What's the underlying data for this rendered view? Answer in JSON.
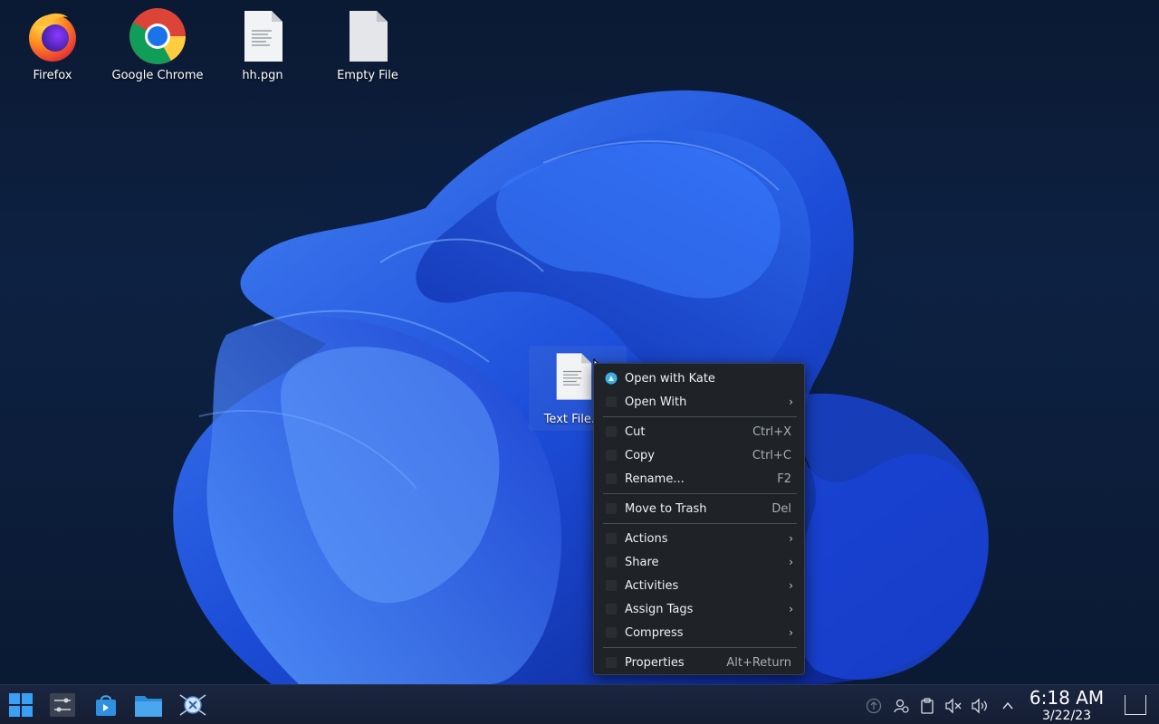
{
  "desktop": {
    "icons": [
      {
        "label": "Firefox",
        "icon": "firefox-icon"
      },
      {
        "label": "Google Chrome",
        "icon": "chrome-icon"
      },
      {
        "label": "hh.pgn",
        "icon": "text-file-icon"
      },
      {
        "label": "Empty File",
        "icon": "empty-file-icon"
      }
    ],
    "selected_file": {
      "label": "Text File...",
      "icon": "text-file-icon"
    }
  },
  "context_menu": {
    "items": [
      {
        "label": "Open with Kate",
        "icon": "kate-icon"
      },
      {
        "label": "Open With",
        "has_submenu": true
      },
      {
        "label": "Cut",
        "shortcut": "Ctrl+X"
      },
      {
        "label": "Copy",
        "shortcut": "Ctrl+C"
      },
      {
        "label": "Rename...",
        "shortcut": "F2"
      },
      {
        "label": "Move to Trash",
        "shortcut": "Del"
      },
      {
        "label": "Actions",
        "has_submenu": true
      },
      {
        "label": "Share",
        "has_submenu": true
      },
      {
        "label": "Activities",
        "has_submenu": true
      },
      {
        "label": "Assign Tags",
        "has_submenu": true
      },
      {
        "label": "Compress",
        "has_submenu": true
      },
      {
        "label": "Properties",
        "shortcut": "Alt+Return"
      }
    ]
  },
  "taskbar": {
    "launchers": [
      "start-menu-icon",
      "system-settings-icon",
      "discover-store-icon",
      "file-manager-icon",
      "kde-connect-icon"
    ],
    "tray": [
      "updates-icon",
      "user-icon",
      "clipboard-icon",
      "microphone-muted-icon",
      "volume-icon",
      "expand-tray-icon"
    ],
    "clock": {
      "time": "6:18 AM",
      "date": "3/22/23"
    }
  },
  "colors": {
    "menu_bg": "#1f2327",
    "accent": "#3daee9",
    "taskbar_bg": "#151e33"
  }
}
